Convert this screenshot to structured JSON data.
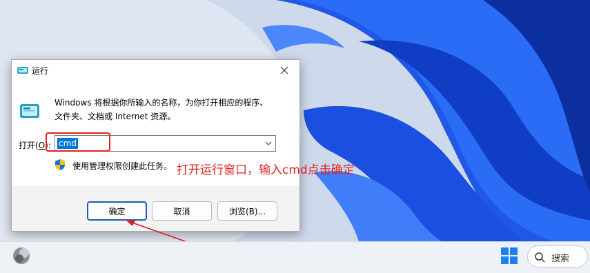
{
  "dialog": {
    "title": "运行",
    "description_line1": "Windows 将根据你所输入的名称，为你打开相应的程序、",
    "description_line2": "文件夹、文档或 Internet 资源。",
    "open_label_prefix": "打开(",
    "open_label_key": "O",
    "open_label_suffix": "):",
    "input_value": "cmd",
    "admin_note": "使用管理权限创建此任务。",
    "ok_label": "确定",
    "cancel_label": "取消",
    "browse_label": "浏览(B)..."
  },
  "annotation": {
    "text": "打开运行窗口，输入cmd点击确定",
    "color": "#e02020"
  },
  "taskbar": {
    "search_label": "搜索"
  },
  "icons": [
    "run-app-icon",
    "close-icon",
    "chevron-down-icon",
    "uac-shield-icon",
    "widgets-icon",
    "windows-start-icon",
    "search-icon"
  ],
  "colors": {
    "wallpaper_blue": "#1a4fe0",
    "selection": "#0078d7",
    "annotation_red": "#e02020"
  }
}
